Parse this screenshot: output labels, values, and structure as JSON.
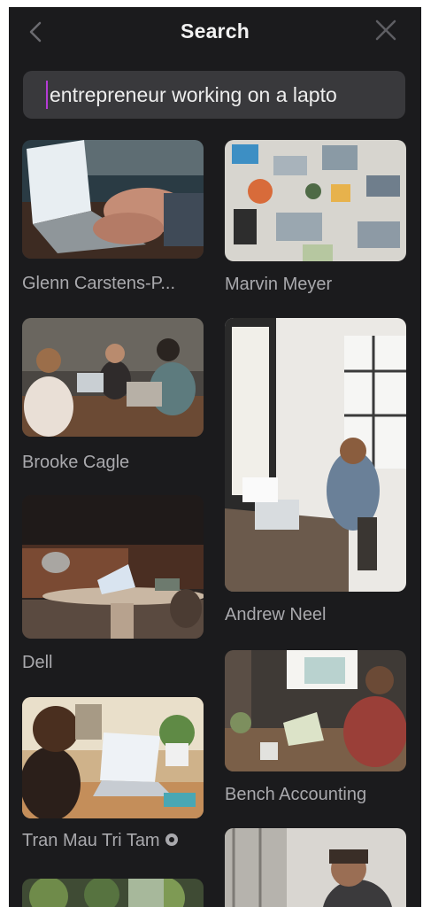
{
  "header": {
    "title": "Search",
    "back_icon": "chevron-left-icon",
    "close_icon": "close-icon"
  },
  "search": {
    "value": "entrepreneur working on a lapto"
  },
  "results": [
    {
      "id": "r1",
      "author": "Glenn Carstens-P...",
      "scene": "hands typing on laptop"
    },
    {
      "id": "r2",
      "author": "Marvin Meyer",
      "scene": "top view of desk with laptops"
    },
    {
      "id": "r3",
      "author": "Brooke Cagle",
      "scene": "three women with laptops"
    },
    {
      "id": "r4",
      "author": "Andrew Neel",
      "scene": "woman working by window"
    },
    {
      "id": "r5",
      "author": "Dell",
      "scene": "laptop on coffee table"
    },
    {
      "id": "r6",
      "author": "Bench Accounting",
      "scene": "man at laptop by window"
    },
    {
      "id": "r7",
      "author": "Tran Mau Tri Tam",
      "scene": "woman at laptop desk"
    },
    {
      "id": "r8",
      "author": "",
      "scene": "man in suit"
    },
    {
      "id": "r9",
      "author": "",
      "scene": "plants window"
    }
  ],
  "colors": {
    "panel_bg": "#1b1b1d",
    "search_bg": "#39393c",
    "caret": "#b53bd6",
    "caption": "#a9a9ad"
  }
}
